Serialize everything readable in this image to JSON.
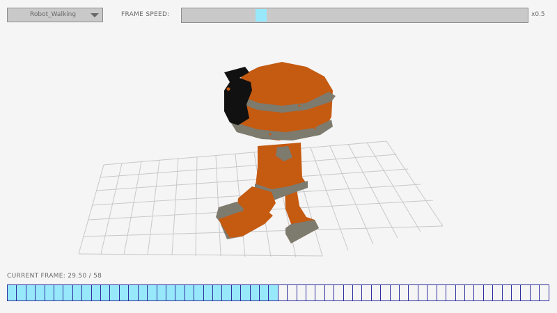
{
  "animation_select": {
    "selected": "Robot_Walking"
  },
  "frame_speed": {
    "label": "FRAME SPEED:",
    "value_text": "x0.5",
    "fraction": 0.22
  },
  "current_frame": {
    "label": "CURRENT FRAME: 29.50 / 58",
    "current": 29.5,
    "total": 58
  },
  "timeline": {
    "tick_count": 58
  },
  "colors": {
    "robot_body": "#c55a11",
    "robot_bands": "#7d7a6e",
    "robot_eye": "#111111",
    "grid": "#c8c8c8",
    "ui_panel": "#c9c9c9",
    "accent": "#97e8fb",
    "timeline_border": "#2e2e9e"
  }
}
